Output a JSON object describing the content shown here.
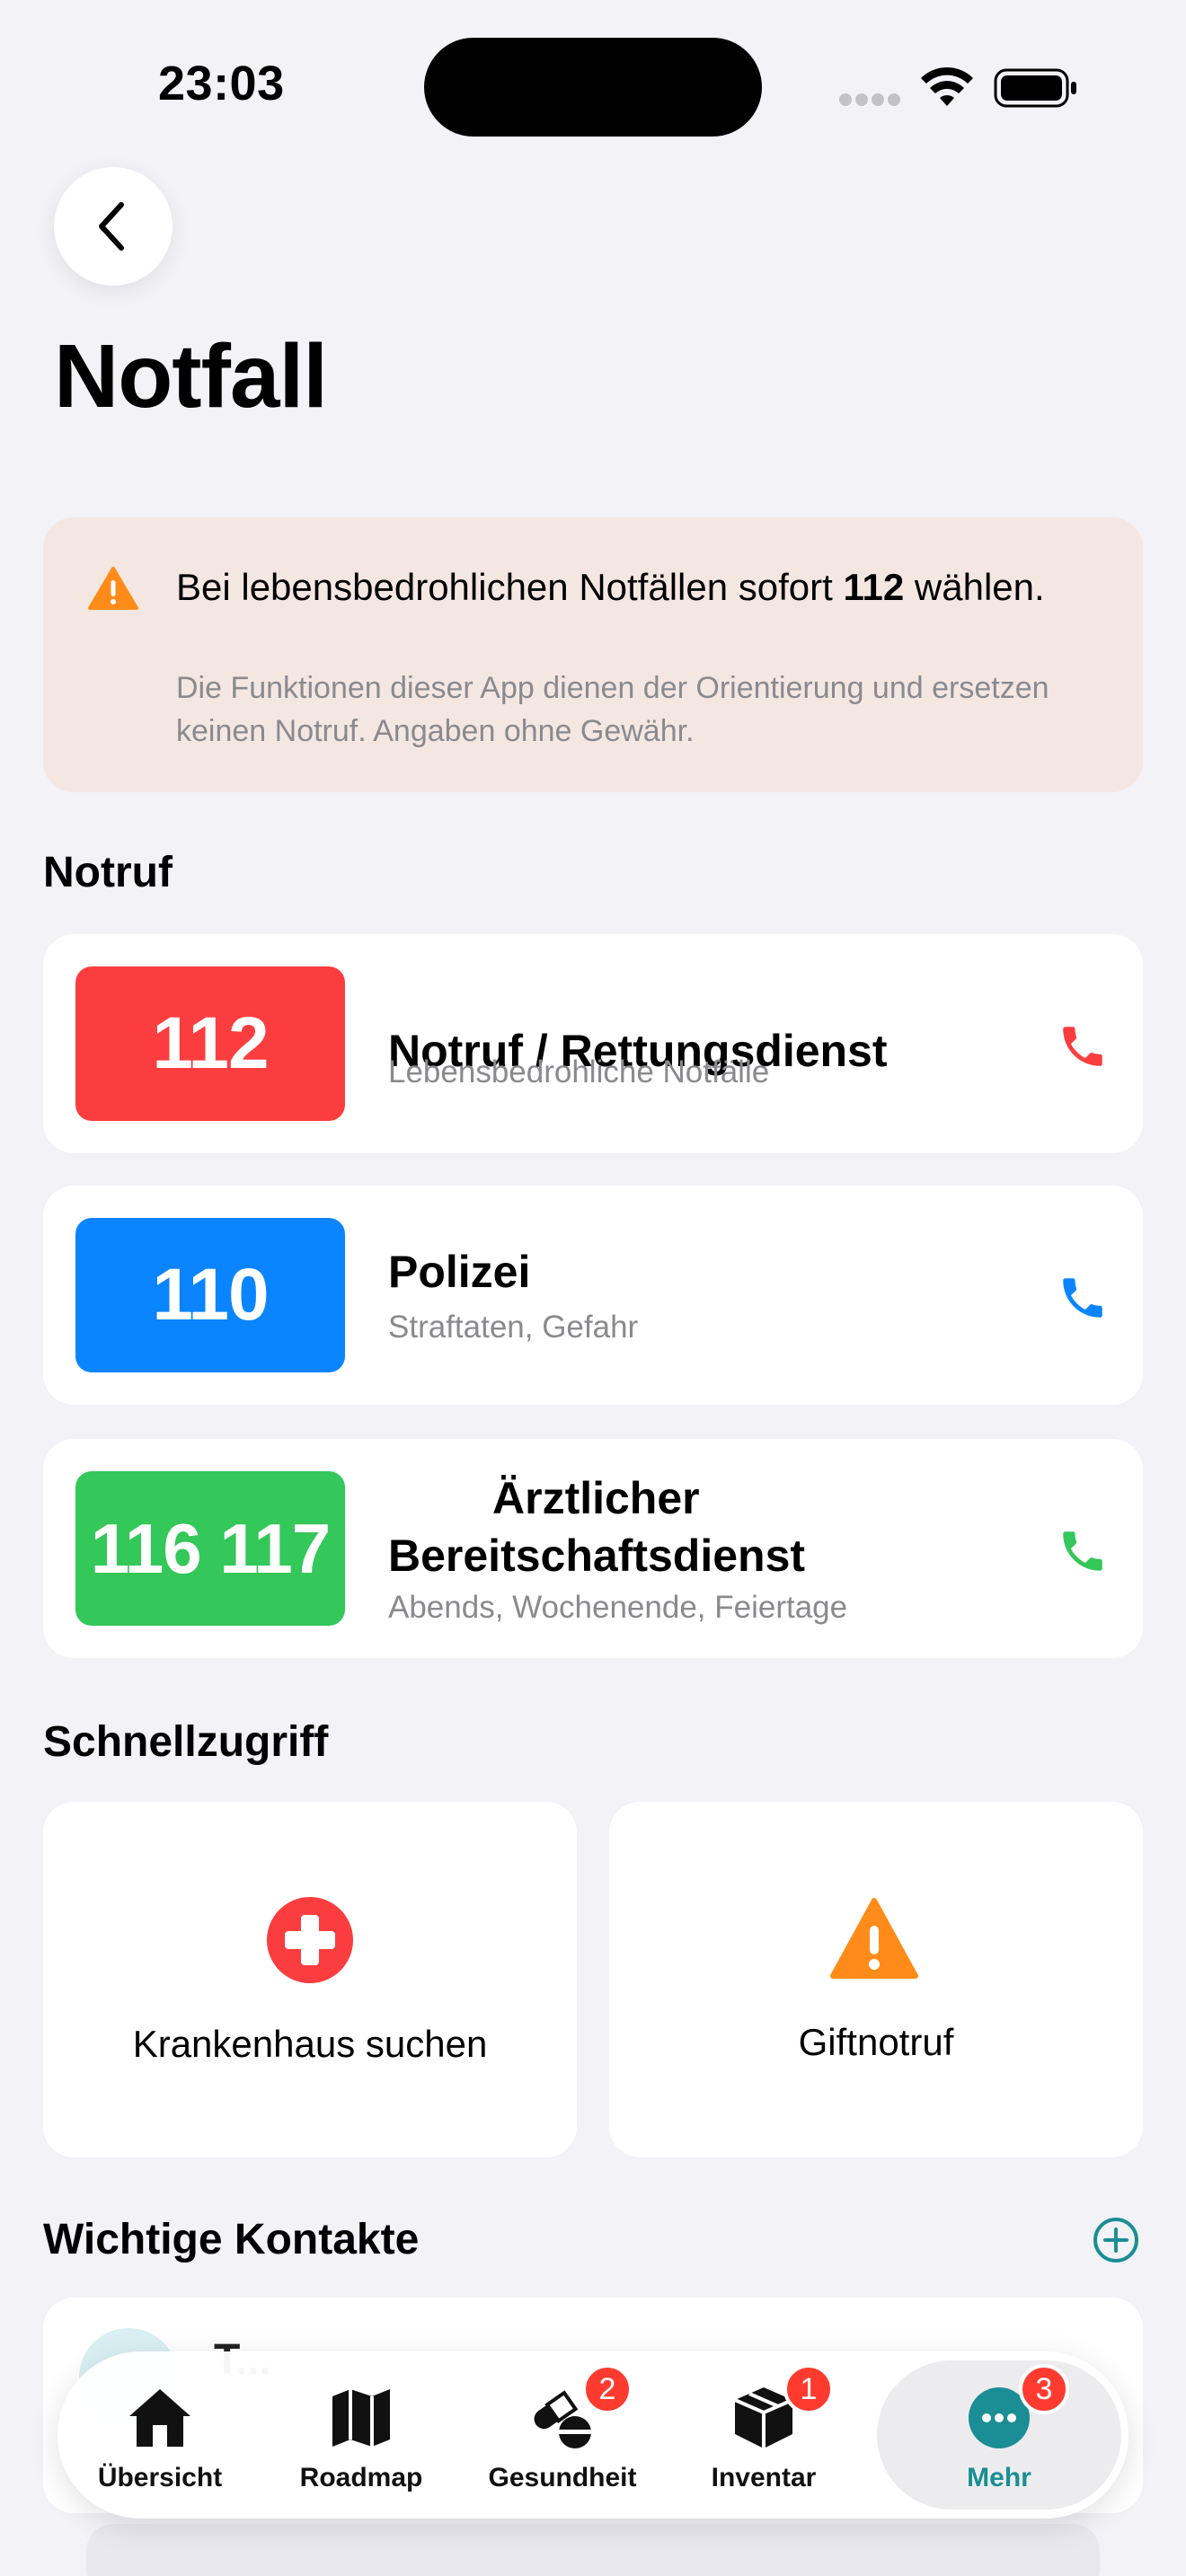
{
  "status_bar": {
    "time": "23:03"
  },
  "page": {
    "title": "Notfall"
  },
  "warning": {
    "title_prefix": "Bei lebensbedrohlichen Notfällen sofort ",
    "title_number": "112",
    "title_suffix": " wählen.",
    "subtitle": "Die Funktionen dieser App dienen der Orientierung und ersetzen keinen Notruf. Angaben ohne Gewähr."
  },
  "sections": {
    "notruf": "Notruf",
    "schnellzugriff": "Schnellzugriff",
    "kontakte": "Wichtige Kontakte"
  },
  "emergency_numbers": [
    {
      "number": "112",
      "title": "Notruf / Rettungsdienst",
      "subtitle": "Lebensbedrohliche Notfälle",
      "color": "#fc3d3f"
    },
    {
      "number": "110",
      "title": "Polizei",
      "subtitle": "Straftaten, Gefahr",
      "color": "#0a84ff"
    },
    {
      "number": "116 117",
      "title": "Ärztlicher Bereitschaftsdienst",
      "subtitle": "Abends, Wochenende, Feiertage",
      "color": "#34c759"
    }
  ],
  "quick_access": [
    {
      "label": "Krankenhaus suchen",
      "icon": "hospital-cross-icon",
      "color": "#fc3d3f"
    },
    {
      "label": "Giftnotruf",
      "icon": "warning-triangle-icon",
      "color": "#ff8c1a"
    }
  ],
  "contacts": [
    {
      "name": "T..."
    }
  ],
  "tab_bar": {
    "tabs": [
      {
        "label": "Übersicht",
        "icon": "house-icon",
        "badge": ""
      },
      {
        "label": "Roadmap",
        "icon": "map-icon",
        "badge": ""
      },
      {
        "label": "Gesundheit",
        "icon": "pills-icon",
        "badge": "2"
      },
      {
        "label": "Inventar",
        "icon": "box-icon",
        "badge": "1"
      },
      {
        "label": "Mehr",
        "icon": "more-icon",
        "badge": "3"
      }
    ],
    "active_color": "#1a8e94"
  }
}
